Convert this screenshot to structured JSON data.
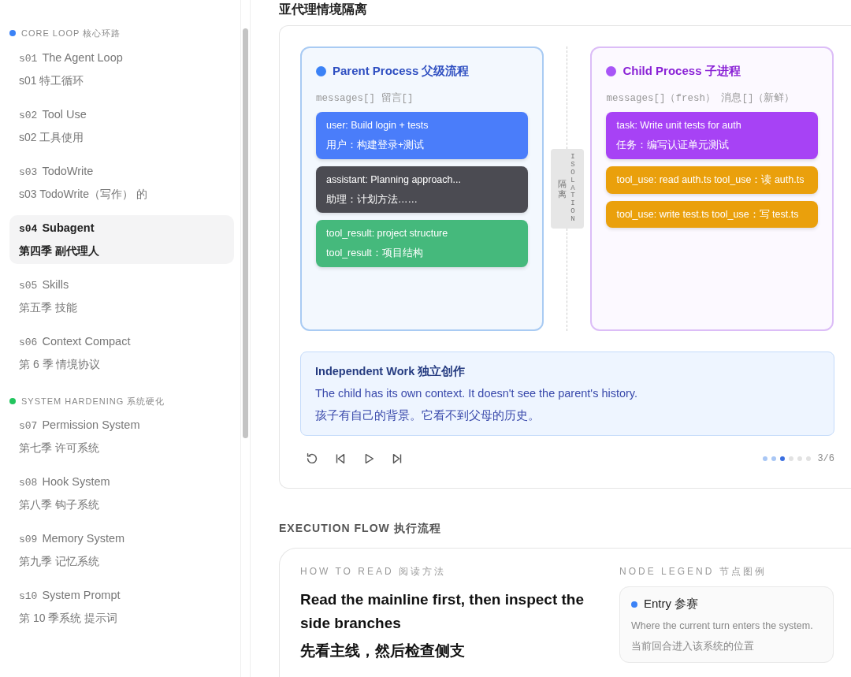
{
  "sidebar": {
    "groups": [
      {
        "title": "CORE LOOP",
        "title_zh": "核心环路",
        "color": "#3b82f6",
        "items": [
          {
            "code": "s01",
            "title": "The Agent Loop",
            "subtitle": "s01  特工循环",
            "selected": false
          },
          {
            "code": "s02",
            "title": "Tool Use",
            "subtitle": "s02  工具使用",
            "selected": false
          },
          {
            "code": "s03",
            "title": "TodoWrite",
            "subtitle": "s03 TodoWrite（写作） 的",
            "selected": false
          },
          {
            "code": "s04",
            "title": "Subagent",
            "subtitle": "第四季 副代理人",
            "selected": true
          },
          {
            "code": "s05",
            "title": "Skills",
            "subtitle": "第五季 技能",
            "selected": false
          },
          {
            "code": "s06",
            "title": "Context Compact",
            "subtitle": "第 6 季 情境协议",
            "selected": false
          }
        ]
      },
      {
        "title": "SYSTEM HARDENING",
        "title_zh": "系统硬化",
        "color": "#22c55e",
        "items": [
          {
            "code": "s07",
            "title": "Permission System",
            "subtitle": "第七季 许可系统",
            "selected": false
          },
          {
            "code": "s08",
            "title": "Hook System",
            "subtitle": "第八季 钩子系统",
            "selected": false
          },
          {
            "code": "s09",
            "title": "Memory System",
            "subtitle": "第九季 记忆系统",
            "selected": false
          },
          {
            "code": "s10",
            "title": "System Prompt",
            "subtitle": "第 10 季系统 提示词",
            "selected": false
          }
        ]
      }
    ]
  },
  "page_title": "亚代理情境隔离",
  "demo": {
    "processes": [
      {
        "title": "Parent Process",
        "title_zh": "父级流程",
        "color": "#3b82f6",
        "caption": "messages[]  留言[]",
        "messages": [
          {
            "kind": "user",
            "text": "user: Build login + tests",
            "text_zh": "用户：构建登录+测试"
          },
          {
            "kind": "assistant",
            "text": "assistant: Planning approach...",
            "text_zh": "助理：计划方法……"
          },
          {
            "kind": "result",
            "text": "tool_result: project structure",
            "text_zh": "tool_result：项目结构"
          }
        ]
      },
      {
        "title": "Child Process",
        "title_zh": "子进程",
        "color": "#a855f7",
        "caption": "messages[]（fresh） 消息[]（新鲜）",
        "messages": [
          {
            "kind": "task",
            "text": "task: Write unit tests for auth",
            "text_zh": "任务：编写认证单元测试"
          },
          {
            "kind": "tool",
            "text": "tool_use: read auth.ts  tool_use：读 auth.ts"
          },
          {
            "kind": "tool",
            "text": "tool_use: write test.ts  tool_use：写 test.ts"
          }
        ]
      }
    ],
    "divider": {
      "label": "ISOLATION",
      "label_zh": "隔离"
    },
    "note": {
      "title": "Independent Work",
      "title_zh": "独立创作",
      "text": "The child has its own context. It doesn't see the parent's history.",
      "text_zh": "孩子有自己的背景。它看不到父母的历史。"
    },
    "steps": [
      {
        "done": true,
        "selected": false
      },
      {
        "done": true,
        "selected": false
      },
      {
        "done": true,
        "selected": true
      },
      {
        "done": false,
        "selected": false
      },
      {
        "done": false,
        "selected": false
      },
      {
        "done": false,
        "selected": false
      }
    ],
    "step_counter": "3/6"
  },
  "flow": {
    "heading": "EXECUTION FLOW",
    "heading_zh": "执行流程",
    "how_label": "HOW TO READ",
    "how_label_zh": "阅读方法",
    "how_text": "Read the mainline first, then inspect the side branches",
    "how_text_zh": "先看主线，然后检查侧支",
    "legend_label": "NODE LEGEND",
    "legend_label_zh": "节点图例",
    "legend": [
      {
        "title": "Entry",
        "title_zh": "参赛",
        "color": "#3b82f6",
        "text": "Where the current turn enters the system.",
        "text_zh": "当前回合进入该系统的位置"
      }
    ]
  }
}
